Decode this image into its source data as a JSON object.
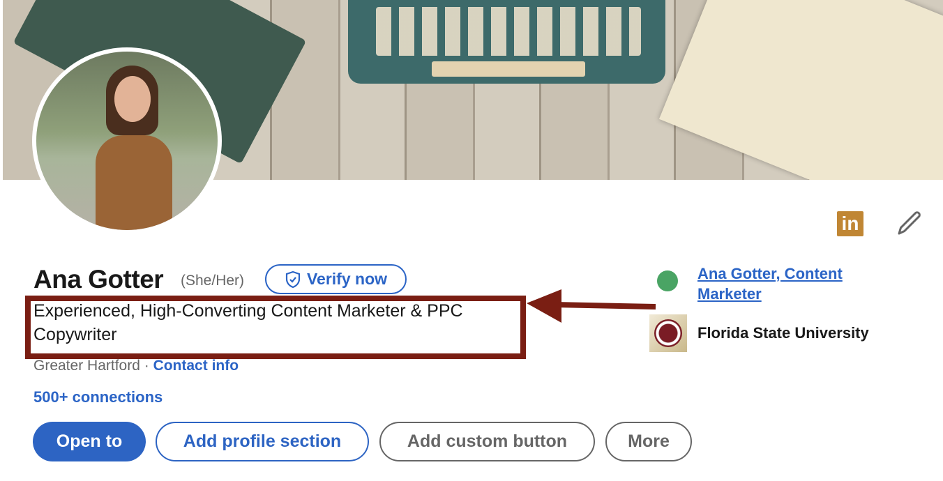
{
  "profile": {
    "name": "Ana Gotter",
    "pronouns": "(She/Her)",
    "verify_label": "Verify now",
    "headline": "Experienced, High-Converting Content Marketer & PPC Copywriter",
    "location": "Greater Hartford",
    "separator": " · ",
    "contact_info": "Contact info",
    "connections": "500+ connections"
  },
  "actions": {
    "open_to": "Open to",
    "add_profile_section": "Add profile section",
    "add_custom_button": "Add custom button",
    "more": "More"
  },
  "sidebar": {
    "current_company": "Ana Gotter, Content Marketer",
    "education": "Florida State University"
  },
  "icons": {
    "linkedin": "in",
    "edit": "pencil-icon",
    "verify": "shield-check-icon"
  },
  "colors": {
    "accent": "#2d64c3",
    "annotation": "#7a1e13",
    "linkedin_badge": "#c08634"
  }
}
